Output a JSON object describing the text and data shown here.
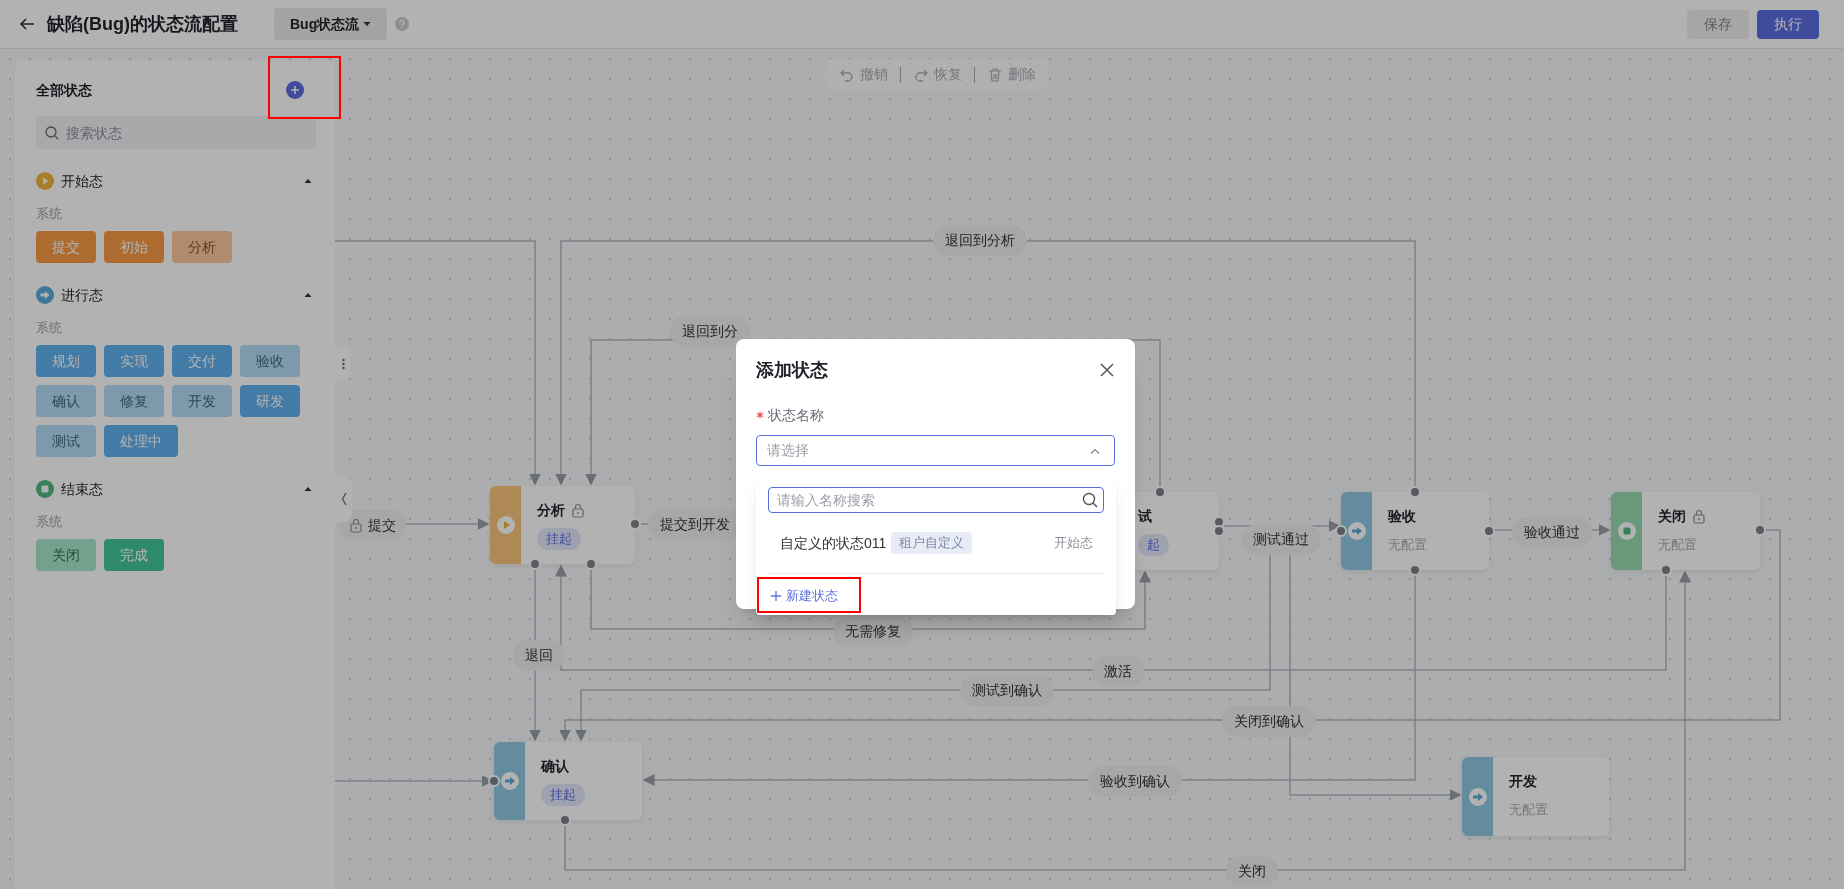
{
  "header": {
    "title": "缺陷(Bug)的状态流配置",
    "flow_selector": "Bug状态流",
    "actions": [
      {
        "label": "保存",
        "disabled": true
      },
      {
        "label": "执行",
        "disabled": false
      }
    ]
  },
  "toolbar": [
    {
      "label": "撤销",
      "kind": "undo"
    },
    {
      "label": "恢复",
      "kind": "redo"
    },
    {
      "label": "删除",
      "kind": "delete"
    }
  ],
  "sidebar": {
    "title": "全部状态",
    "add_button": {
      "highlighted": true
    },
    "search": {
      "placeholder": "搜索状态"
    },
    "groups": [
      {
        "name": "开始态",
        "kind": "start",
        "expanded": true,
        "sections": [
          {
            "name": "系统",
            "states": [
              {
                "label": "提交",
                "disabled": false
              },
              {
                "label": "初始",
                "disabled": false
              },
              {
                "label": "分析",
                "disabled": true
              }
            ]
          }
        ]
      },
      {
        "name": "进行态",
        "kind": "progress",
        "expanded": true,
        "sections": [
          {
            "name": "系统",
            "states": [
              {
                "label": "规划",
                "disabled": false
              },
              {
                "label": "实现",
                "disabled": false
              },
              {
                "label": "交付",
                "disabled": false
              },
              {
                "label": "验收",
                "disabled": true
              },
              {
                "label": "确认",
                "disabled": true
              },
              {
                "label": "修复",
                "disabled": true
              },
              {
                "label": "开发",
                "disabled": true
              },
              {
                "label": "研发",
                "disabled": false
              },
              {
                "label": "测试",
                "disabled": true
              },
              {
                "label": "处理中",
                "disabled": false
              }
            ]
          }
        ]
      },
      {
        "name": "结束态",
        "kind": "end",
        "expanded": true,
        "sections": [
          {
            "name": "系统",
            "states": [
              {
                "label": "关闭",
                "disabled": true
              },
              {
                "label": "完成",
                "disabled": false
              }
            ]
          }
        ]
      }
    ]
  },
  "canvas": {
    "nodes": [
      {
        "title": "分析",
        "kind": "start",
        "locked": true,
        "badge": "挂起"
      },
      {
        "title": "试",
        "locked": false,
        "badge": "起"
      },
      {
        "title": "验收",
        "kind": "progress",
        "locked": false,
        "subtitle": "无配置"
      },
      {
        "title": "关闭",
        "kind": "end",
        "locked": true,
        "subtitle": "无配置"
      },
      {
        "title": "确认",
        "kind": "progress",
        "locked": false,
        "badge": "挂起"
      },
      {
        "title": "开发",
        "kind": "progress",
        "locked": false,
        "subtitle": "无配置"
      }
    ],
    "transitions": [
      {
        "label": "提交",
        "locked": true
      },
      {
        "label": "退回到分析",
        "locked": false
      },
      {
        "label": "退回到分",
        "locked": false
      },
      {
        "label": "提交到开发",
        "locked": false
      },
      {
        "label": "测试通过",
        "locked": false
      },
      {
        "label": "验收通过",
        "locked": false
      },
      {
        "label": "无需修复",
        "locked": false
      },
      {
        "label": "退回",
        "locked": false
      },
      {
        "label": "激活",
        "locked": false
      },
      {
        "label": "测试到确认",
        "locked": false
      },
      {
        "label": "关闭到确认",
        "locked": false
      },
      {
        "label": "验收到确认",
        "locked": false
      },
      {
        "label": "关闭",
        "locked": false
      }
    ]
  },
  "dialog": {
    "title": "添加状态",
    "field": {
      "label": "状态名称",
      "required": true,
      "placeholder": "请选择",
      "open": true
    },
    "dropdown": {
      "search_placeholder": "请输入名称搜索",
      "options": [
        {
          "name": "自定义的状态011",
          "tag": "租户自定义",
          "type": "开始态"
        }
      ],
      "create_label": "新建状态",
      "create_highlighted": true
    }
  }
}
